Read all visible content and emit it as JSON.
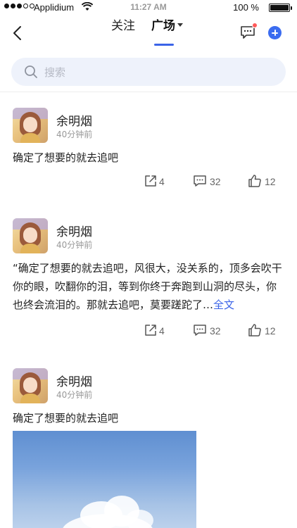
{
  "status_bar": {
    "carrier": "Applidium",
    "time": "11:27 AM",
    "battery": "100 %"
  },
  "nav": {
    "tabs": [
      {
        "label": "关注"
      },
      {
        "label": "广场"
      }
    ],
    "active_tab": "广场"
  },
  "search": {
    "placeholder": "搜索"
  },
  "posts": [
    {
      "author": "余明烟",
      "time": "40分钟前",
      "content": "确定了想要的就去追吧",
      "share_count": "4",
      "comment_count": "32",
      "like_count": "12"
    },
    {
      "author": "余明烟",
      "time": "40分钟前",
      "content": "“确定了想要的就去追吧，风很大，没关系的，顶多会吹干你的眼，吹翻你的泪，等到你终于奔跑到山洞的尽头，你也终会流泪的。那就去追吧，莫要蹉跎了…",
      "more_label": "全文",
      "share_count": "4",
      "comment_count": "32",
      "like_count": "12"
    },
    {
      "author": "余明烟",
      "time": "40分钟前",
      "content": "确定了想要的就去追吧"
    }
  ],
  "colors": {
    "accent": "#3b64e8",
    "badge": "#ff5a5a",
    "search_bg": "#eef2fb"
  }
}
